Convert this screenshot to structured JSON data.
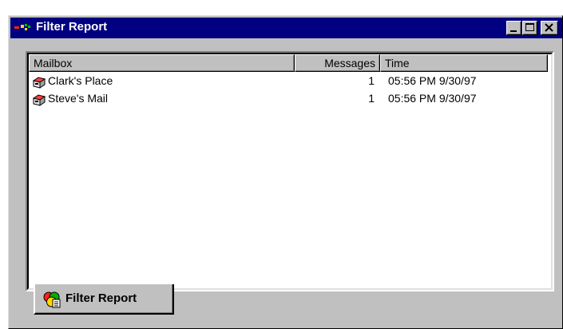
{
  "window": {
    "title": "Filter Report",
    "icons": {
      "app": "app-icon",
      "minimize": "minimize-icon",
      "maximize": "maximize-icon",
      "close": "close-icon"
    },
    "colors": {
      "titlebar": "#000080",
      "face": "#c0c0c0"
    }
  },
  "list": {
    "columns": [
      {
        "label": "Mailbox"
      },
      {
        "label": "Messages"
      },
      {
        "label": "Time"
      }
    ],
    "rows": [
      {
        "mailbox": "Clark's Place",
        "messages": "1",
        "time": "05:56 PM 9/30/97",
        "icon": "mailbox-icon"
      },
      {
        "mailbox": "Steve's Mail",
        "messages": "1",
        "time": "05:56 PM 9/30/97",
        "icon": "mailbox-icon"
      }
    ]
  },
  "tabs": [
    {
      "label": "Filter Report",
      "icon": "filter-report-icon"
    }
  ]
}
